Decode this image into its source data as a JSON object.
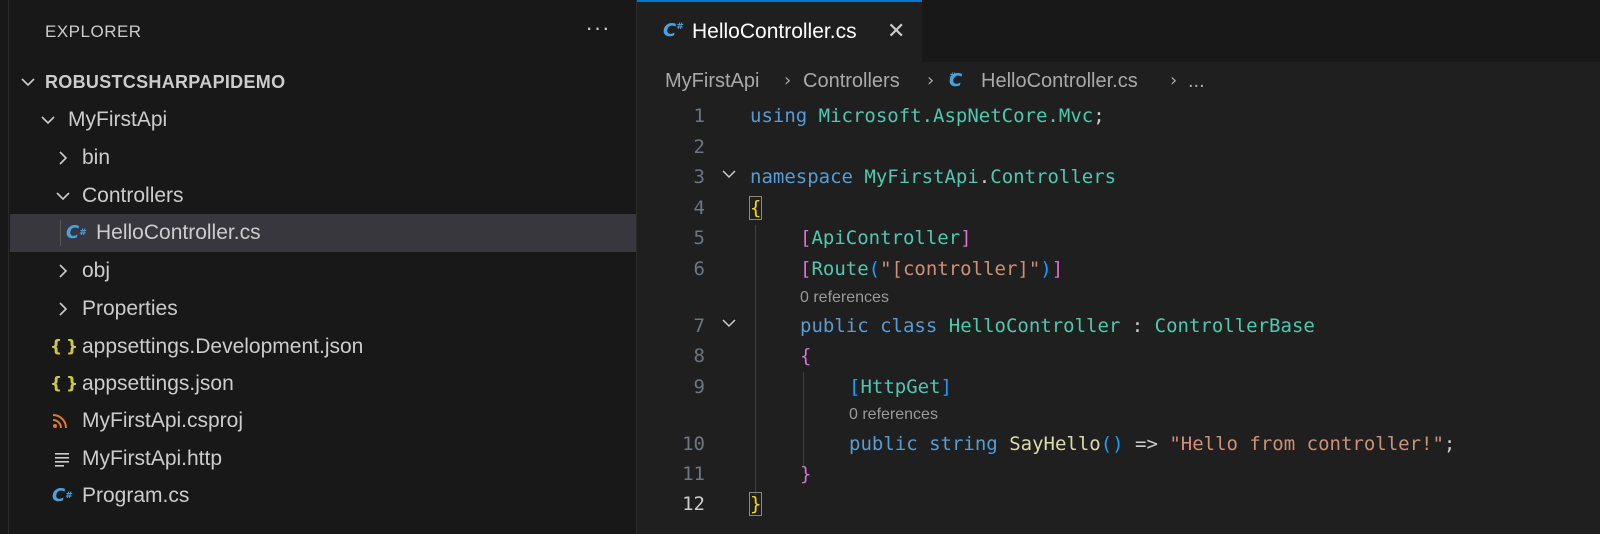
{
  "sidebar": {
    "header": "EXPLORER",
    "more_glyph": "···",
    "root": "ROBUSTCSHARPAPIDEMO",
    "items": [
      {
        "label": "MyFirstApi"
      },
      {
        "label": "bin"
      },
      {
        "label": "Controllers"
      },
      {
        "label": "HelloController.cs"
      },
      {
        "label": "obj"
      },
      {
        "label": "Properties"
      },
      {
        "label": "appsettings.Development.json"
      },
      {
        "label": "appsettings.json"
      },
      {
        "label": "MyFirstApi.csproj"
      },
      {
        "label": "MyFirstApi.http"
      },
      {
        "label": "Program.cs"
      }
    ]
  },
  "icons": {
    "csharp_glyph": "C",
    "csharp_sup": "#",
    "json_glyph": "{ }",
    "close_glyph": "✕",
    "chevron_right": "›",
    "ellipsis": "..."
  },
  "tab": {
    "label": "HelloController.cs"
  },
  "breadcrumb": {
    "parts": [
      "MyFirstApi",
      "Controllers",
      "HelloController.cs",
      "..."
    ]
  },
  "code": {
    "line_numbers": [
      "1",
      "2",
      "3",
      "4",
      "5",
      "6",
      "7",
      "8",
      "9",
      "10",
      "11",
      "12"
    ],
    "l1": {
      "kw": "using",
      "ns": "Microsoft.AspNetCore.Mvc",
      "end": ";"
    },
    "l3": {
      "kw": "namespace",
      "ns1": "MyFirstApi",
      "dot": ".",
      "ns2": "Controllers"
    },
    "l4": {
      "brace": "{"
    },
    "l5": {
      "open": "[",
      "attr": "ApiController",
      "close": "]"
    },
    "l6": {
      "open": "[",
      "attr": "Route",
      "popen": "(",
      "str": "\"[controller]\"",
      "pclose": ")",
      "close": "]"
    },
    "refs1": "0 references",
    "l7": {
      "kw1": "public",
      "kw2": "class",
      "type": "HelloController",
      "colon": " : ",
      "base": "ControllerBase"
    },
    "l8": {
      "brace": "{"
    },
    "l9": {
      "open": "[",
      "attr": "HttpGet",
      "close": "]"
    },
    "refs2": "0 references",
    "l10": {
      "kw1": "public",
      "kw2": "string",
      "fn": "SayHello",
      "parens": "()",
      "arrow": " => ",
      "str": "\"Hello from controller!\"",
      "end": ";"
    },
    "l11": {
      "brace": "}"
    },
    "l12": {
      "brace": "}"
    }
  },
  "colors": {
    "accent": "#0078d4",
    "selected_row": "#37373d",
    "keyword": "#569cd6",
    "type": "#4ec9b0",
    "string": "#ce9178",
    "function": "#dcdcaa"
  }
}
